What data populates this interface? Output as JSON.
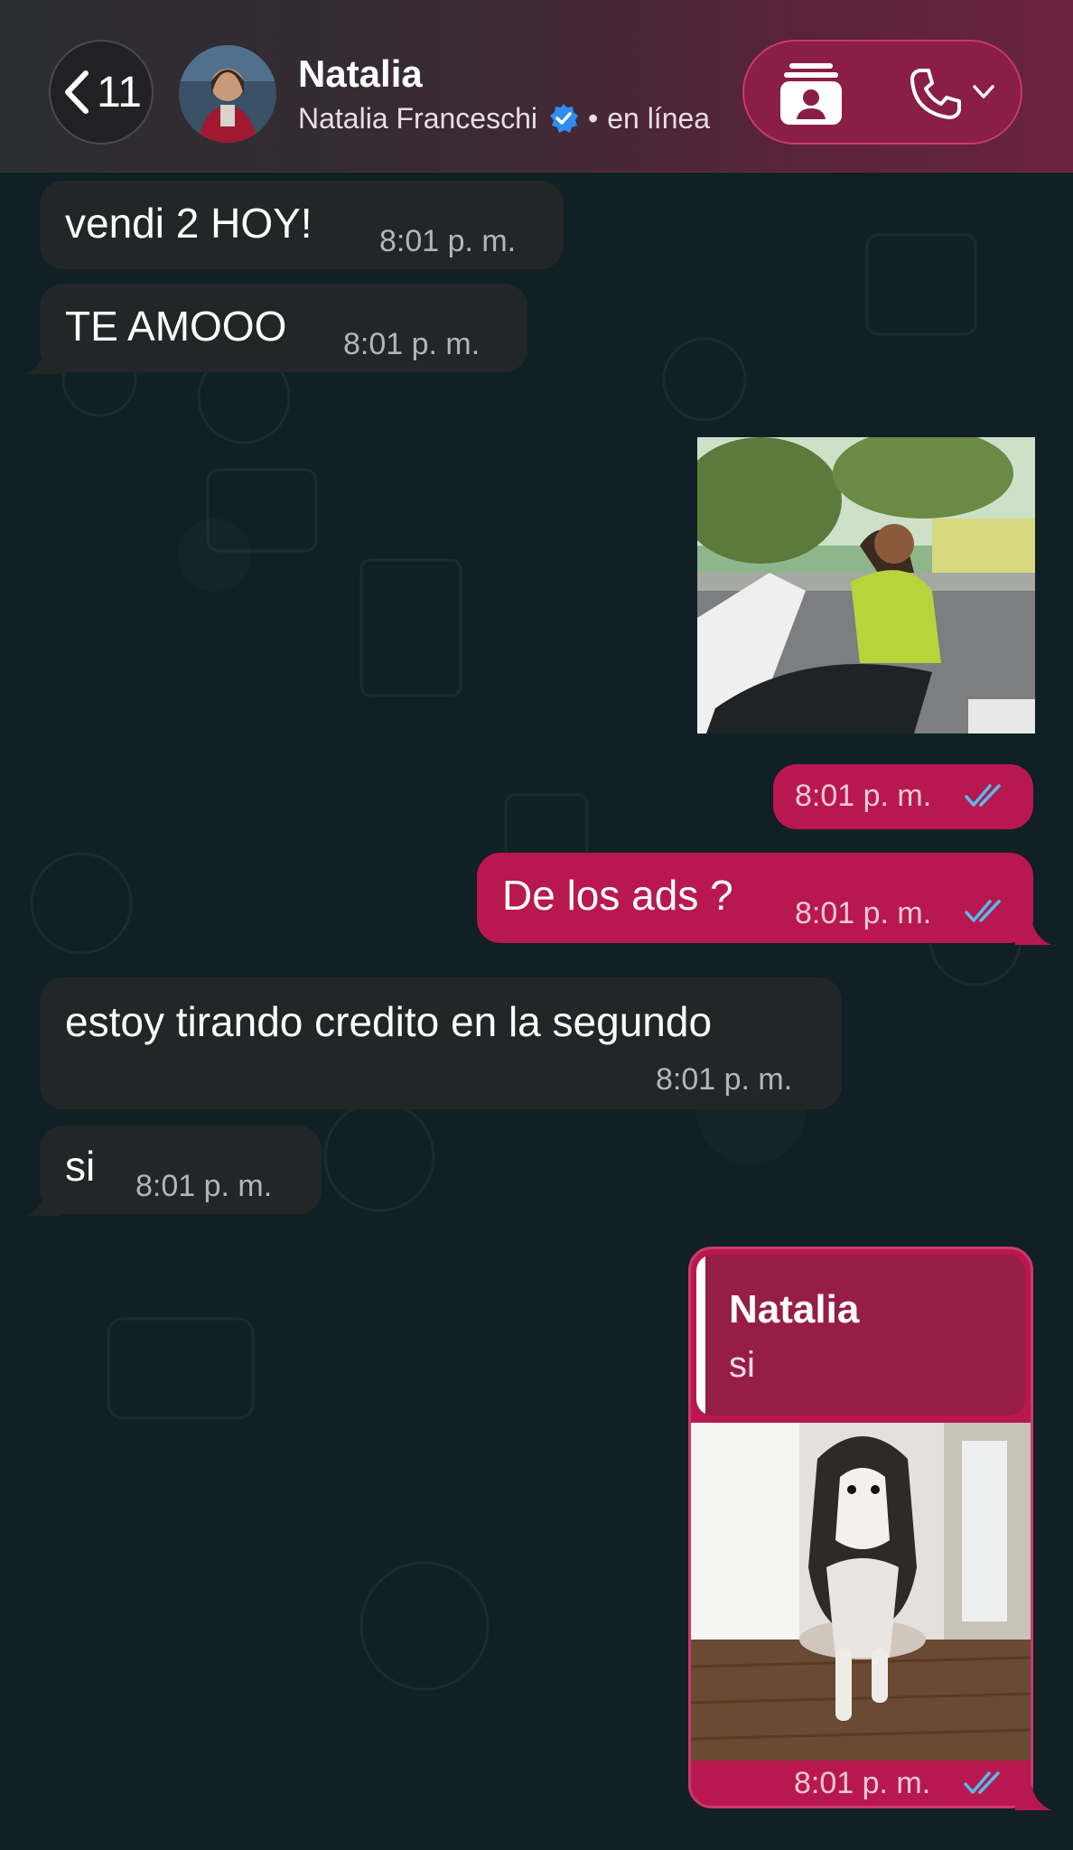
{
  "header": {
    "back_count": "11",
    "contact_name": "Natalia",
    "contact_fullname": "Natalia Franceschi",
    "status_separator": "•",
    "status": "en línea",
    "icons": [
      "chevron-left-icon",
      "verified-badge-icon",
      "video-call-icon",
      "phone-icon",
      "chevron-down-icon"
    ]
  },
  "messages": [
    {
      "direction": "in",
      "text": "vendi 2 HOY!",
      "time": "8:01 p. m."
    },
    {
      "direction": "in",
      "text": "TE AMOOO",
      "time": "8:01 p. m."
    },
    {
      "direction": "out",
      "type": "gif",
      "media": "man-riding-scooter",
      "time": "8:01 p. m.",
      "read": true
    },
    {
      "direction": "out",
      "text": "De los ads ?",
      "time": "8:01 p. m.",
      "read": true
    },
    {
      "direction": "in",
      "text": "estoy tirando credito en la segundo",
      "time": "8:01 p. m."
    },
    {
      "direction": "in",
      "text": "si",
      "time": "8:01 p. m."
    },
    {
      "direction": "out",
      "type": "gif-reply",
      "reply_to_name": "Natalia",
      "reply_to_text": "si",
      "media": "husky-dog-standing",
      "time": "8:01 p. m.",
      "read": true
    }
  ],
  "colors": {
    "outgoing_bubble": "#b8184f",
    "incoming_bubble": "#232627",
    "read_ticks": "#53bdeb",
    "chat_background": "#102024"
  }
}
